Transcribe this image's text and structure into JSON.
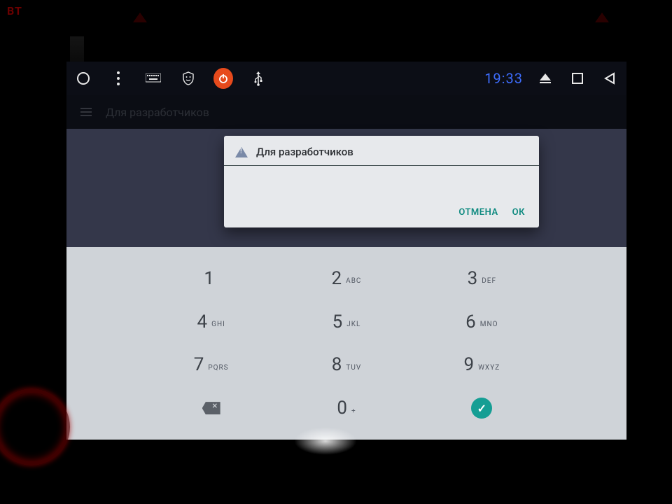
{
  "physical": {
    "bt_label": "BT"
  },
  "statusbar": {
    "clock": "19:33"
  },
  "page": {
    "title": "Для разработчиков"
  },
  "dialog": {
    "title": "Для разработчиков",
    "cancel": "ОТМЕНА",
    "ok": "ОК"
  },
  "keypad": {
    "keys": [
      {
        "digit": "1",
        "letters": ""
      },
      {
        "digit": "2",
        "letters": "ABC"
      },
      {
        "digit": "3",
        "letters": "DEF"
      },
      {
        "digit": "4",
        "letters": "GHI"
      },
      {
        "digit": "5",
        "letters": "JKL"
      },
      {
        "digit": "6",
        "letters": "MNO"
      },
      {
        "digit": "7",
        "letters": "PQRS"
      },
      {
        "digit": "8",
        "letters": "TUV"
      },
      {
        "digit": "9",
        "letters": "WXYZ"
      },
      {
        "digit": "0",
        "letters": "+"
      }
    ]
  }
}
